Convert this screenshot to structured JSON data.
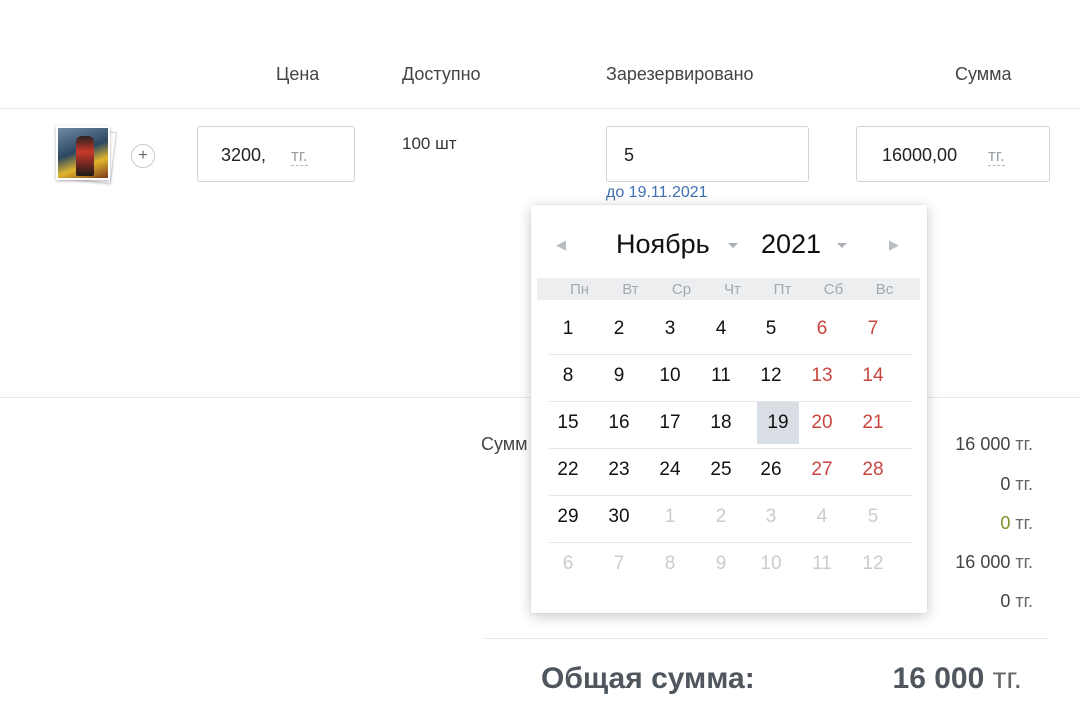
{
  "table": {
    "headers": {
      "price": "Цена",
      "available": "Доступно",
      "reserved": "Зарезервировано",
      "sum": "Сумма"
    },
    "row": {
      "add_symbol": "+",
      "price_value": "3200,",
      "price_unit": "тг.",
      "available": "100 шт",
      "reserved_value": "5",
      "reserved_until": "до 19.11.2021",
      "sum_value": "16000,00",
      "sum_unit": "тг."
    }
  },
  "summary": {
    "label": "Сумм",
    "lines": [
      {
        "value": "16 000",
        "unit": "тг."
      },
      {
        "value": "0",
        "unit": "тг."
      },
      {
        "value": "0",
        "unit": "тг."
      },
      {
        "value": "16 000",
        "unit": "тг."
      },
      {
        "value": "0",
        "unit": "тг."
      }
    ],
    "total_label": "Общая сумма:",
    "total_value": "16 000",
    "total_unit": "тг."
  },
  "calendar": {
    "month": "Ноябрь",
    "year": "2021",
    "prev_icon": "◀",
    "next_icon": "▶",
    "weekdays": [
      "Пн",
      "Вт",
      "Ср",
      "Чт",
      "Пт",
      "Сб",
      "Вс"
    ],
    "weeks": [
      [
        "1",
        "2",
        "3",
        "4",
        "5",
        "6",
        "7"
      ],
      [
        "8",
        "9",
        "10",
        "11",
        "12",
        "13",
        "14"
      ],
      [
        "15",
        "16",
        "17",
        "18",
        "19",
        "20",
        "21"
      ],
      [
        "22",
        "23",
        "24",
        "25",
        "26",
        "27",
        "28"
      ],
      [
        "29",
        "30",
        "1",
        "2",
        "3",
        "4",
        "5"
      ],
      [
        "6",
        "7",
        "8",
        "9",
        "10",
        "11",
        "12"
      ]
    ],
    "selected_day": "19"
  },
  "colors": {
    "link": "#3e6fb0",
    "weekend": "#c9453f",
    "muted_day": "#c8ccd0",
    "selected_bg": "#d9dee4",
    "positive": "#7f8f2a"
  }
}
